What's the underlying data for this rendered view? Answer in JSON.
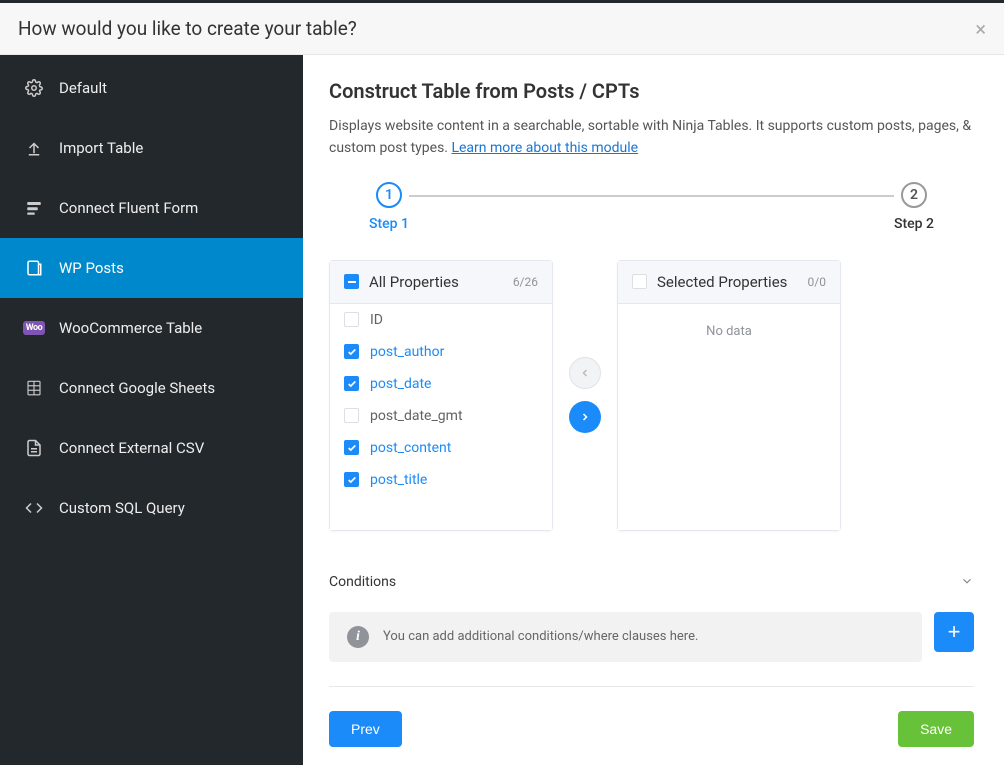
{
  "header": {
    "title": "How would you like to create your table?"
  },
  "sidebar": {
    "items": [
      {
        "label": "Default"
      },
      {
        "label": "Import Table"
      },
      {
        "label": "Connect Fluent Form"
      },
      {
        "label": "WP Posts"
      },
      {
        "label": "WooCommerce Table"
      },
      {
        "label": "Connect Google Sheets"
      },
      {
        "label": "Connect External CSV"
      },
      {
        "label": "Custom SQL Query"
      }
    ],
    "woo_badge": "Woo"
  },
  "main": {
    "title": "Construct Table from Posts / CPTs",
    "desc_prefix": "Displays website content in a searchable, sortable with Ninja Tables. It supports custom posts, pages, & custom post types. ",
    "learn_more": "Learn more about this module"
  },
  "stepper": {
    "step1_num": "1",
    "step1_label": "Step 1",
    "step2_num": "2",
    "step2_label": "Step 2"
  },
  "transfer": {
    "left_title": "All Properties",
    "left_count": "6/26",
    "right_title": "Selected Properties",
    "right_count": "0/0",
    "empty": "No data",
    "items": [
      {
        "label": "ID",
        "checked": false
      },
      {
        "label": "post_author",
        "checked": true
      },
      {
        "label": "post_date",
        "checked": true
      },
      {
        "label": "post_date_gmt",
        "checked": false
      },
      {
        "label": "post_content",
        "checked": true
      },
      {
        "label": "post_title",
        "checked": true
      }
    ]
  },
  "conditions": {
    "title": "Conditions",
    "info": "You can add additional conditions/where clauses here."
  },
  "footer": {
    "prev": "Prev",
    "save": "Save"
  }
}
